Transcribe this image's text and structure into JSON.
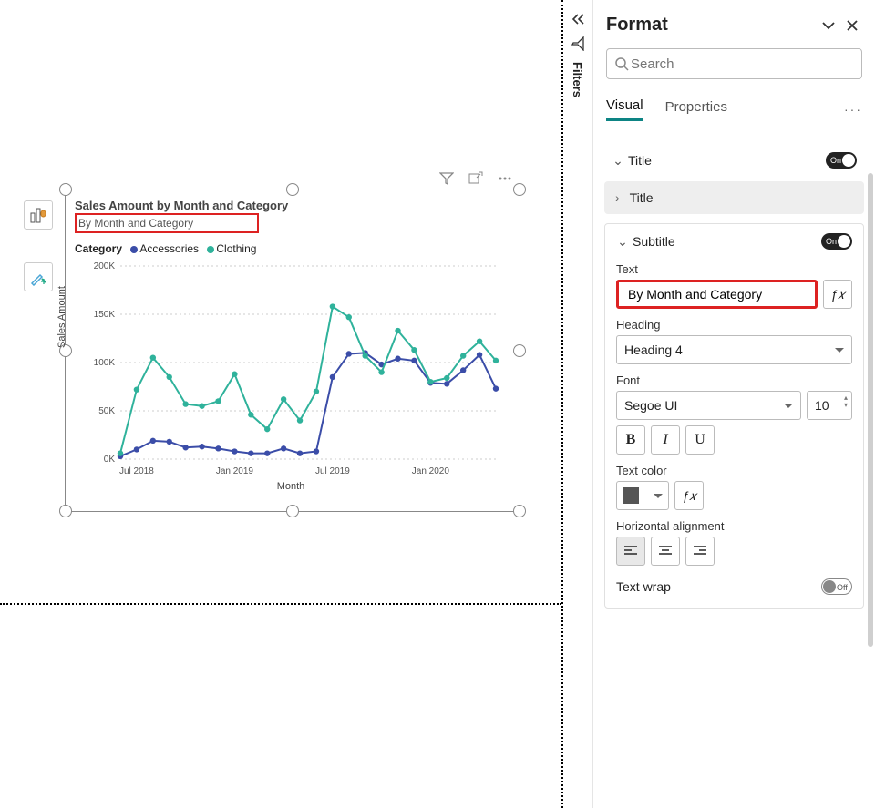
{
  "canvas": {
    "tools": {
      "first": "chart-type-icon",
      "second": "paint-brush-icon"
    },
    "visual_header": [
      "filter-icon",
      "focus-icon",
      "more-icon"
    ]
  },
  "chart": {
    "title": "Sales Amount by Month and Category",
    "subtitle": "By Month and Category",
    "legend_label": "Category",
    "y_label": "Sales Amount",
    "x_label": "Month"
  },
  "chart_data": {
    "type": "line",
    "xlabel": "Month",
    "ylabel": "Sales Amount",
    "ylim": [
      0,
      200000
    ],
    "y_ticks": [
      "0K",
      "50K",
      "100K",
      "150K",
      "200K"
    ],
    "x_ticks": [
      "Jul 2018",
      "Jan 2019",
      "Jul 2019",
      "Jan 2020"
    ],
    "categories": [
      "2018-06",
      "2018-07",
      "2018-08",
      "2018-09",
      "2018-10",
      "2018-11",
      "2018-12",
      "2019-01",
      "2019-02",
      "2019-03",
      "2019-04",
      "2019-05",
      "2019-06",
      "2019-07",
      "2019-08",
      "2019-09",
      "2019-10",
      "2019-11",
      "2019-12",
      "2020-01",
      "2020-02",
      "2020-03",
      "2020-04",
      "2020-05"
    ],
    "series": [
      {
        "name": "Accessories",
        "color": "#3b4da8",
        "values": [
          3000,
          10000,
          19000,
          18000,
          12000,
          13000,
          11000,
          8000,
          6000,
          6000,
          11000,
          6000,
          8000,
          85000,
          109000,
          110000,
          98000,
          104000,
          102000,
          79000,
          78000,
          92000,
          108000,
          73000
        ]
      },
      {
        "name": "Clothing",
        "color": "#2fb29b",
        "values": [
          6000,
          72000,
          105000,
          85000,
          57000,
          55000,
          60000,
          88000,
          46000,
          31000,
          62000,
          40000,
          70000,
          158000,
          147000,
          107000,
          90000,
          133000,
          113000,
          80000,
          84000,
          107000,
          122000,
          102000
        ]
      }
    ]
  },
  "filters_tab": {
    "label": "Filters"
  },
  "format": {
    "title": "Format",
    "search_placeholder": "Search",
    "tabs": {
      "visual": "Visual",
      "properties": "Properties"
    },
    "sections": {
      "title": {
        "label": "Title",
        "on": "On",
        "inner": "Title"
      },
      "subtitle": {
        "label": "Subtitle",
        "on": "On",
        "text_label": "Text",
        "text_value": "By Month and Category",
        "heading_label": "Heading",
        "heading_value": "Heading 4",
        "font_label": "Font",
        "font_value": "Segoe UI",
        "font_size": "10",
        "bold": "B",
        "italic": "I",
        "underline": "U",
        "color_label": "Text color",
        "align_label": "Horizontal alignment",
        "wrap_label": "Text wrap",
        "off": "Off"
      }
    }
  }
}
